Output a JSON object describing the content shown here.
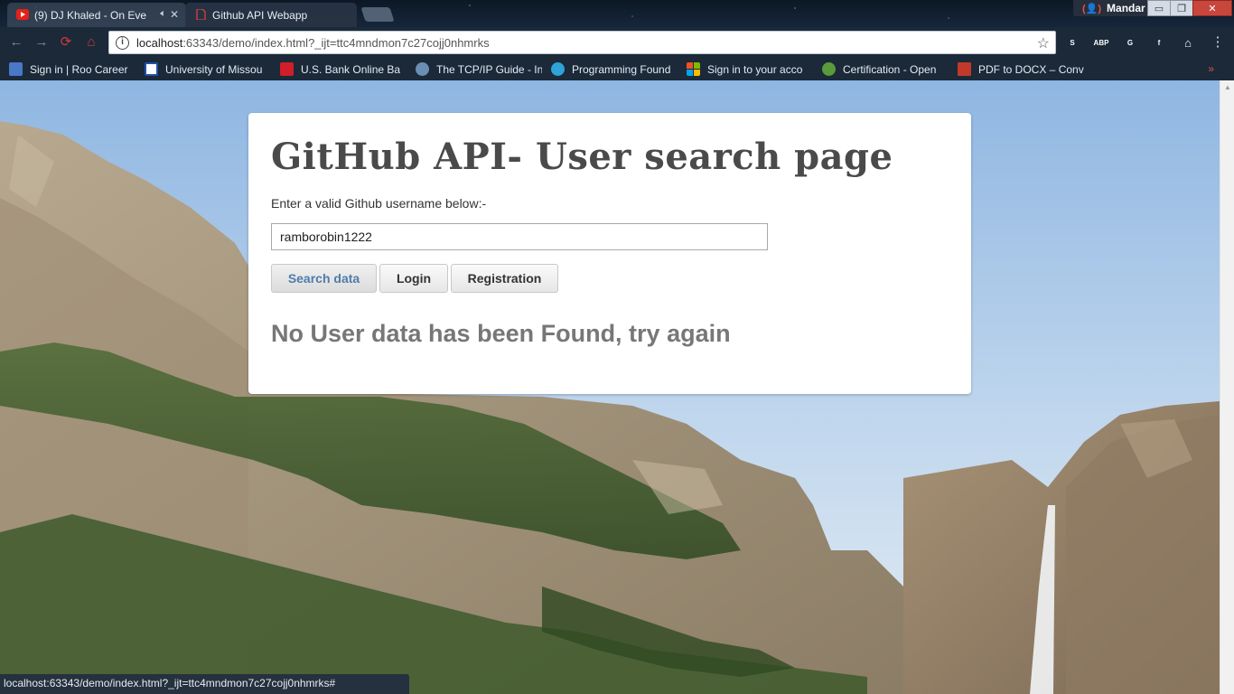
{
  "browser": {
    "tabs": [
      {
        "title": "(9) DJ Khaled - On Eve",
        "state": "inactive",
        "favicon": "youtube-icon",
        "audio": "speaker-icon"
      },
      {
        "title": "Github API Webapp",
        "state": "active",
        "favicon": "page-icon"
      }
    ],
    "profile_name": "Mandar",
    "window_controls": {
      "minimize": "▭",
      "maximize": "❐",
      "close": "✕"
    },
    "url_host": "localhost",
    "url_rest": ":63343/demo/index.html?_ijt=ttc4mndmon7c27cojj0nhmrks",
    "extensions": [
      {
        "name": "skype-icon",
        "label": "S",
        "color": "#8a8f96"
      },
      {
        "name": "adblock-icon",
        "label": "ABP",
        "color": "#c4171c"
      },
      {
        "name": "translate-icon",
        "label": "G",
        "color": "#3c78d8"
      },
      {
        "name": "flash-icon",
        "label": "f",
        "color": "#d86a1c"
      },
      {
        "name": "home-icon",
        "label": "⌂",
        "color": "#4c5866"
      }
    ],
    "menu_icon": "⋮",
    "bookmarks": [
      {
        "label": "Sign in | Roo Career",
        "icon": "roo-career-icon",
        "color": "#4a78c8"
      },
      {
        "label": "University of Missou",
        "icon": "umkc-icon",
        "color": "#2050a8"
      },
      {
        "label": "U.S. Bank Online Ba",
        "icon": "usbank-icon",
        "color": "#d01e2a"
      },
      {
        "label": "The TCP/IP Guide - In",
        "icon": "tcpip-guide-icon",
        "color": "#6a8fb5"
      },
      {
        "label": "Programming Found",
        "icon": "programming-icon",
        "color": "#2fa3d8"
      },
      {
        "label": "Sign in to your acco",
        "icon": "microsoft-icon",
        "color": "#f25022"
      },
      {
        "label": "Certification - Open",
        "icon": "certification-icon",
        "color": "#5a9a3a"
      },
      {
        "label": "PDF to DOCX – Conv",
        "icon": "pdf-icon",
        "color": "#c0392b"
      }
    ],
    "bookmarks_more": "»",
    "status_url": "localhost:63343/demo/index.html?_ijt=ttc4mndmon7c27cojj0nhmrks#"
  },
  "page": {
    "title": "GitHub API- User search page",
    "help_text": "Enter a valid Github username below:-",
    "username_value": "ramborobin1222",
    "buttons": {
      "search": "Search data",
      "login": "Login",
      "registration": "Registration"
    },
    "result_message": "No User data has been Found, try again"
  }
}
